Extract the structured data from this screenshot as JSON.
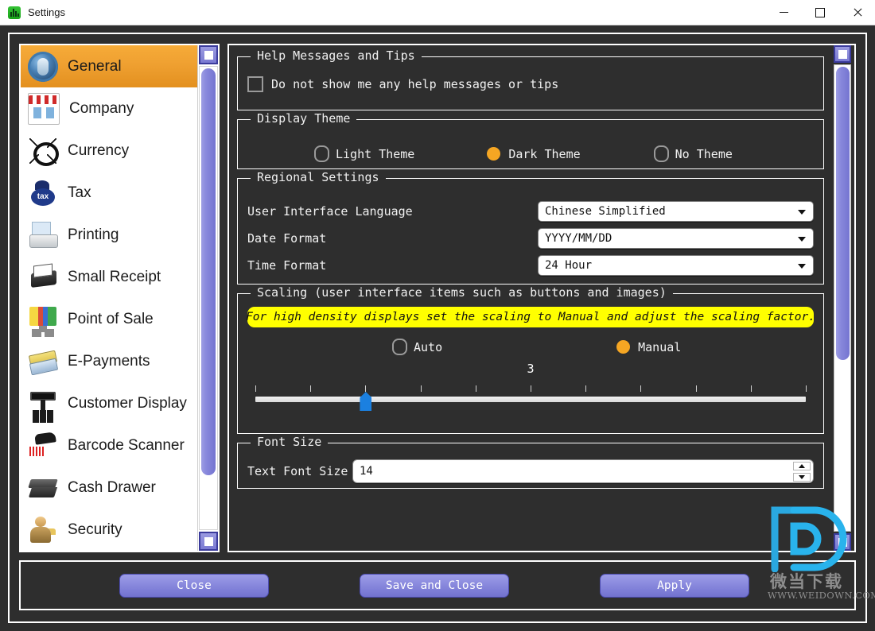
{
  "window": {
    "title": "Settings",
    "icon": "app-icon",
    "controls": {
      "minimize": "minimize",
      "maximize": "maximize",
      "close": "close"
    }
  },
  "sidebar": {
    "items": [
      {
        "label": "General",
        "icon": "general-icon",
        "active": true
      },
      {
        "label": "Company",
        "icon": "storefront-icon",
        "active": false
      },
      {
        "label": "Currency",
        "icon": "currency-icon",
        "active": false
      },
      {
        "label": "Tax",
        "icon": "tax-bag-icon",
        "active": false
      },
      {
        "label": "Printing",
        "icon": "printer-icon",
        "active": false
      },
      {
        "label": "Small Receipt",
        "icon": "receipt-printer-icon",
        "active": false
      },
      {
        "label": "Point of Sale",
        "icon": "pos-terminal-icon",
        "active": false
      },
      {
        "label": "E-Payments",
        "icon": "credit-cards-icon",
        "active": false
      },
      {
        "label": "Customer Display",
        "icon": "customer-display-icon",
        "active": false
      },
      {
        "label": "Barcode Scanner",
        "icon": "barcode-scanner-icon",
        "active": false
      },
      {
        "label": "Cash Drawer",
        "icon": "cash-drawer-icon",
        "active": false
      },
      {
        "label": "Security",
        "icon": "security-user-icon",
        "active": false
      }
    ],
    "scrollbar": {
      "up": "scroll-up-arrow",
      "down": "scroll-down-arrow",
      "thumb_top_pct": 0,
      "thumb_height_pct": 88
    }
  },
  "main": {
    "scrollbar": {
      "up": "scroll-up-arrow",
      "down": "scroll-down-arrow",
      "thumb_top_pct": 0,
      "thumb_height_pct": 63
    },
    "help_messages": {
      "legend": "Help Messages and Tips",
      "checkbox_label": "Do not show me any help messages or tips",
      "checked": false
    },
    "display_theme": {
      "legend": "Display Theme",
      "options": [
        {
          "label": "Light Theme",
          "selected": false
        },
        {
          "label": "Dark Theme",
          "selected": true
        },
        {
          "label": "No Theme",
          "selected": false
        }
      ]
    },
    "regional": {
      "legend": "Regional Settings",
      "rows": [
        {
          "label": "User Interface Language",
          "value": "Chinese Simplified"
        },
        {
          "label": "Date Format",
          "value": "YYYY/MM/DD"
        },
        {
          "label": "Time Format",
          "value": "24 Hour"
        }
      ]
    },
    "scaling": {
      "legend": "Scaling (user interface items such as buttons and images)",
      "notice": "For high density displays set the scaling to Manual and adjust the scaling factor.",
      "options": [
        {
          "label": "Auto",
          "selected": false
        },
        {
          "label": "Manual",
          "selected": true
        }
      ],
      "slider": {
        "value": "3",
        "tick_count": 11,
        "handle_tick_index": 2
      }
    },
    "font_size": {
      "legend": "Font Size",
      "label": "Text Font Size",
      "value": "14",
      "stepper_up": "stepper-up-arrow",
      "stepper_down": "stepper-down-arrow"
    }
  },
  "footer": {
    "buttons": [
      {
        "label": "Close"
      },
      {
        "label": "Save and Close"
      },
      {
        "label": "Apply"
      }
    ]
  },
  "watermark": {
    "cn_text": "微当下载",
    "url_text": "WWW.WEIDOWN.COM"
  },
  "colors": {
    "accent_orange": "#efa031",
    "selected_radio": "#f5a623",
    "button_purple": "#8a8ade",
    "notice_yellow": "#ffff00",
    "slider_blue": "#1b80e0",
    "background_dark": "#2e2e2e"
  }
}
